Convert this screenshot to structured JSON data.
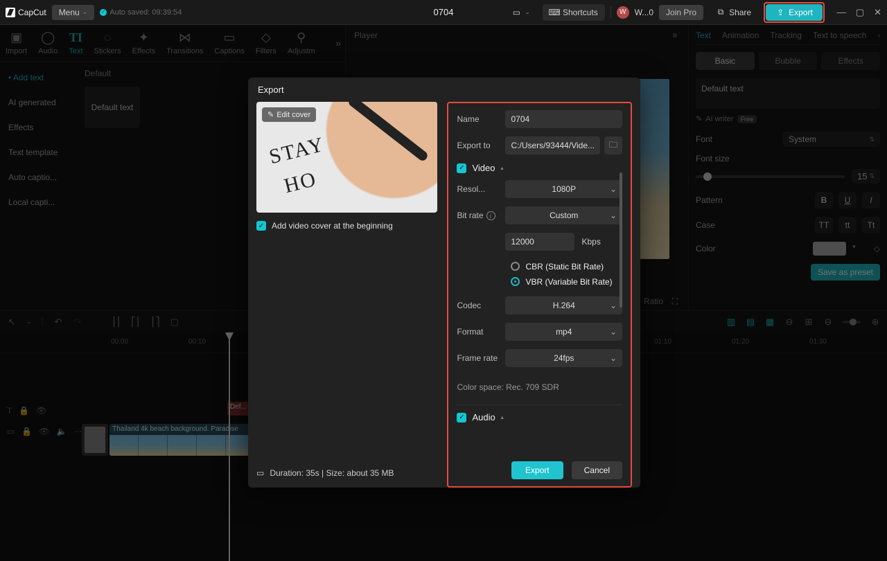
{
  "topbar": {
    "brand": "CapCut",
    "menu": "Menu",
    "autosave": "Auto saved: 09:39:54",
    "project": "0704",
    "shortcuts": "Shortcuts",
    "user": "W...0",
    "user_initial": "W",
    "joinpro": "Join Pro",
    "share": "Share",
    "export": "Export"
  },
  "ribbon": {
    "tabs": [
      "Import",
      "Audio",
      "Text",
      "Stickers",
      "Effects",
      "Transitions",
      "Captions",
      "Filters",
      "Adjustm"
    ],
    "active_tab": 2,
    "side": [
      "Add text",
      "AI generated",
      "Effects",
      "Text template",
      "Auto captio...",
      "Local capti..."
    ],
    "default_label": "Default",
    "default_text": "Default text"
  },
  "player": {
    "title": "Player",
    "ratio": "Ratio"
  },
  "inspector": {
    "tabs": [
      "Text",
      "Animation",
      "Tracking",
      "Text to speech"
    ],
    "subtabs": [
      "Basic",
      "Bubble",
      "Effects"
    ],
    "default_text": "Default text",
    "ai_writer": "AI writer",
    "ai_badge": "Free",
    "font_label": "Font",
    "font_value": "System",
    "fontsize_label": "Font size",
    "fontsize_value": "15",
    "pattern_label": "Pattern",
    "fmt": {
      "b": "B",
      "u": "U",
      "i": "I"
    },
    "case_label": "Case",
    "cases": {
      "upper": "TT",
      "lower": "tt",
      "title": "Tt"
    },
    "color_label": "Color",
    "save_preset": "Save as preset"
  },
  "timeline": {
    "ticks": [
      "00:00",
      "00:10",
      "01:10",
      "01:20",
      "01:30"
    ],
    "text_clip": "Def...",
    "video_clip": "Thailand 4k beach background. Paradise"
  },
  "export": {
    "title": "Export",
    "edit_cover": "Edit cover",
    "cover_line1": "STAY",
    "cover_line2": "HO",
    "add_cover": "Add video cover at the beginning",
    "duration_size": "Duration: 35s | Size: about 35 MB",
    "name_label": "Name",
    "name_value": "0704",
    "exportto_label": "Export to",
    "exportto_value": "C:/Users/93444/Vide...",
    "video_label": "Video",
    "resolution_label": "Resol...",
    "resolution_value": "1080P",
    "bitrate_label": "Bit rate",
    "bitrate_value": "Custom",
    "bitrate_num": "12000",
    "bitrate_unit": "Kbps",
    "cbr": "CBR (Static Bit Rate)",
    "vbr": "VBR (Variable Bit Rate)",
    "codec_label": "Codec",
    "codec_value": "H.264",
    "format_label": "Format",
    "format_value": "mp4",
    "framerate_label": "Frame rate",
    "framerate_value": "24fps",
    "colorspace": "Color space: Rec. 709 SDR",
    "audio_label": "Audio",
    "export_btn": "Export",
    "cancel_btn": "Cancel"
  }
}
